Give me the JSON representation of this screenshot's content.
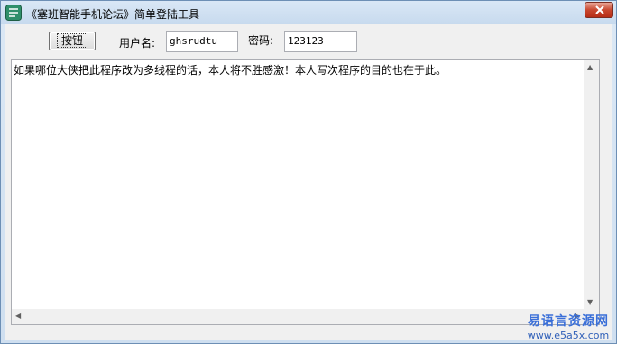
{
  "window": {
    "title": "《塞班智能手机论坛》简单登陆工具"
  },
  "toolbar": {
    "button_label": "按钮",
    "username_label": "用户名:",
    "username_value": "ghsrudtu",
    "password_label": "密码:",
    "password_value": "123123"
  },
  "output": {
    "text": "如果哪位大侠把此程序改为多线程的话，本人将不胜感激！本人写次程序的目的也在于此。"
  },
  "watermark": {
    "line1": "易语言资源网",
    "line2": "www.e5a5x.com"
  },
  "colors": {
    "title_bar": "#c7daee",
    "close_button": "#c8472f",
    "watermark": "#3a6fd8"
  }
}
